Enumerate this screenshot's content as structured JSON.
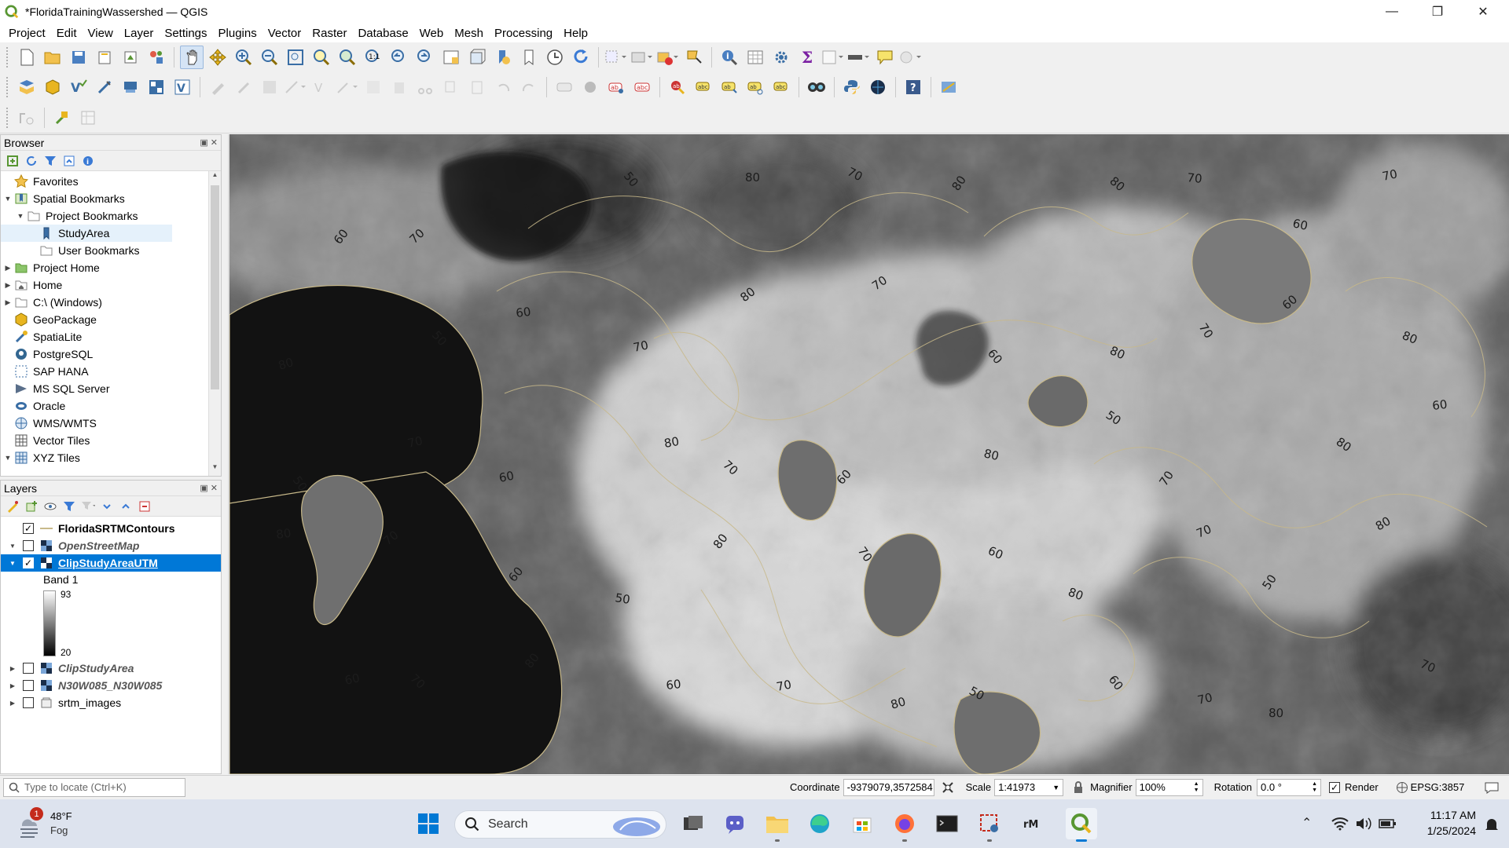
{
  "window": {
    "title": "*FloridaTrainingWassershed — QGIS",
    "controls": [
      "—",
      "❐",
      "✕"
    ]
  },
  "menu": [
    "Project",
    "Edit",
    "View",
    "Layer",
    "Settings",
    "Plugins",
    "Vector",
    "Raster",
    "Database",
    "Web",
    "Mesh",
    "Processing",
    "Help"
  ],
  "browser": {
    "title": "Browser",
    "items": [
      {
        "label": "Favorites",
        "icon": "star-icon",
        "indent": 0,
        "arrow": ""
      },
      {
        "label": "Spatial Bookmarks",
        "icon": "bookmarks-icon",
        "indent": 0,
        "arrow": "▼"
      },
      {
        "label": "Project Bookmarks",
        "icon": "folder-icon",
        "indent": 1,
        "arrow": "▼"
      },
      {
        "label": "StudyArea",
        "icon": "bookmark-icon",
        "indent": 2,
        "arrow": ""
      },
      {
        "label": "User Bookmarks",
        "icon": "folder-icon",
        "indent": 1,
        "arrow": ""
      },
      {
        "label": "Project Home",
        "icon": "project-home-icon",
        "indent": 0,
        "arrow": "▶"
      },
      {
        "label": "Home",
        "icon": "home-icon",
        "indent": 0,
        "arrow": "▶"
      },
      {
        "label": "C:\\ (Windows)",
        "icon": "drive-icon",
        "indent": 0,
        "arrow": "▶"
      },
      {
        "label": "GeoPackage",
        "icon": "geopackage-icon",
        "indent": 0,
        "arrow": ""
      },
      {
        "label": "SpatiaLite",
        "icon": "spatialite-icon",
        "indent": 0,
        "arrow": ""
      },
      {
        "label": "PostgreSQL",
        "icon": "postgresql-icon",
        "indent": 0,
        "arrow": ""
      },
      {
        "label": "SAP HANA",
        "icon": "sap-hana-icon",
        "indent": 0,
        "arrow": ""
      },
      {
        "label": "MS SQL Server",
        "icon": "mssql-icon",
        "indent": 0,
        "arrow": ""
      },
      {
        "label": "Oracle",
        "icon": "oracle-icon",
        "indent": 0,
        "arrow": ""
      },
      {
        "label": "WMS/WMTS",
        "icon": "wms-icon",
        "indent": 0,
        "arrow": ""
      },
      {
        "label": "Vector Tiles",
        "icon": "vector-tiles-icon",
        "indent": 0,
        "arrow": ""
      },
      {
        "label": "XYZ Tiles",
        "icon": "xyz-tiles-icon",
        "indent": 0,
        "arrow": "▼"
      }
    ]
  },
  "layers": {
    "title": "Layers",
    "items": [
      {
        "name": "FloridaSRTMContours",
        "checked": true,
        "style": "bold",
        "icon": "line-layer-icon",
        "arrow": ""
      },
      {
        "name": "OpenStreetMap",
        "checked": false,
        "style": "italic",
        "icon": "raster-layer-icon",
        "arrow": "▼"
      },
      {
        "name": "ClipStudyAreaUTM",
        "checked": true,
        "style": "selected",
        "icon": "raster-layer-icon",
        "arrow": "▼"
      }
    ],
    "band": {
      "label": "Band 1",
      "max": "93",
      "min": "20"
    },
    "more": [
      {
        "name": "ClipStudyArea",
        "checked": false,
        "style": "italic",
        "icon": "raster-layer-icon",
        "arrow": "▶"
      },
      {
        "name": "N30W085_N30W085",
        "checked": false,
        "style": "italic",
        "icon": "raster-layer-icon",
        "arrow": "▶"
      },
      {
        "name": "srtm_images",
        "checked": false,
        "style": "normal",
        "icon": "group-icon",
        "arrow": "▶"
      }
    ]
  },
  "map": {
    "contour_labels": [
      "60",
      "70",
      "60",
      "50",
      "80",
      "70",
      "80",
      "80",
      "70",
      "60",
      "70",
      "80",
      "50",
      "60",
      "70",
      "80",
      "70",
      "60",
      "80",
      "70",
      "60",
      "80",
      "50",
      "70",
      "60",
      "80",
      "70",
      "60",
      "80",
      "50",
      "70",
      "80",
      "60",
      "80",
      "70",
      "60",
      "50",
      "80",
      "70",
      "60",
      "80",
      "70",
      "50",
      "80",
      "60",
      "70",
      "80",
      "60",
      "70",
      "80",
      "50",
      "60",
      "70",
      "80",
      "70",
      "60"
    ]
  },
  "status": {
    "locate_placeholder": "Type to locate (Ctrl+K)",
    "coordinate_label": "Coordinate",
    "coordinate_value": "-9379079,3572584",
    "scale_label": "Scale",
    "scale_value": "1:41973",
    "magnifier_label": "Magnifier",
    "magnifier_value": "100%",
    "rotation_label": "Rotation",
    "rotation_value": "0.0 °",
    "render_label": "Render",
    "crs": "EPSG:3857"
  },
  "taskbar": {
    "weather_temp": "48°F",
    "weather_desc": "Fog",
    "weather_badge": "1",
    "search_label": "Search",
    "time": "11:17 AM",
    "date": "1/25/2024"
  },
  "colors": {
    "accent": "#0078d7",
    "qgis_green": "#589632",
    "contour": "#c8b98a"
  }
}
